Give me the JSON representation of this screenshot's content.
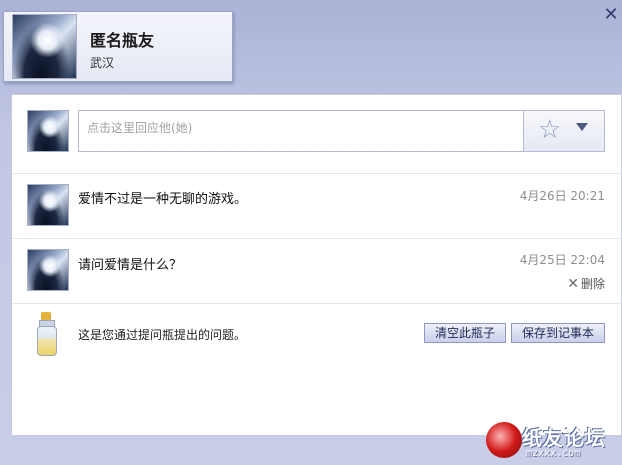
{
  "window": {
    "close_glyph": "✕"
  },
  "sender": {
    "name": "匿名瓶友",
    "location": "武汉"
  },
  "reply": {
    "placeholder": "点击这里回应他(她)",
    "emoji_icon": "star-wand-icon"
  },
  "messages": [
    {
      "text": "爱情不过是一种无聊的游戏。",
      "time": "4月26日 20:21"
    },
    {
      "text": "请问爱情是什么？",
      "time": "4月25日 22:04",
      "delete_label": "删除"
    }
  ],
  "footer": {
    "note": "这是您通过提问瓶提出的问题。",
    "clear_label": "清空此瓶子",
    "save_label": "保存到记事本"
  },
  "watermark": {
    "text": "纸友论坛",
    "sub": "mzxxx.com"
  }
}
